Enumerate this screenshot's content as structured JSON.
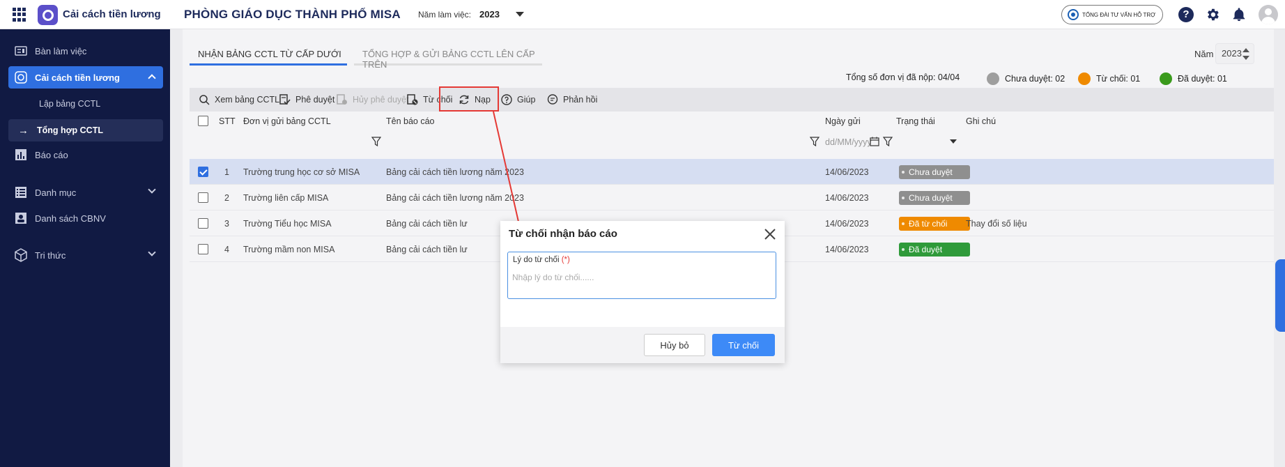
{
  "header": {
    "app_name": "Cải cách tiền lương",
    "org_name": "PHÒNG GIÁO DỤC THÀNH PHỐ MISA",
    "year_label": "Năm làm việc:",
    "year_value": "2023",
    "support_label": "TỔNG ĐÀI TƯ VẤN HỖ TRỢ",
    "help_glyph": "?"
  },
  "sidebar": {
    "items": [
      {
        "label": "Bàn làm việc",
        "icon": "desk-icon"
      },
      {
        "label": "Cải cách tiền lương",
        "icon": "payroll-icon"
      },
      {
        "label": "Lập bảng CCTL"
      },
      {
        "label": "Tổng hợp CCTL"
      },
      {
        "label": "Báo cáo",
        "icon": "report-icon"
      },
      {
        "label": "Danh mục",
        "icon": "list-icon"
      },
      {
        "label": "Danh sách CBNV",
        "icon": "staff-icon"
      },
      {
        "label": "Tri thức",
        "icon": "knowledge-icon"
      }
    ],
    "current_arrow": "→"
  },
  "tabs": [
    {
      "label": "NHẬN BẢNG CCTL TỪ CẤP DƯỚI"
    },
    {
      "label": "TỔNG HỢP & GỬI BẢNG CCTL LÊN CẤP TRÊN"
    }
  ],
  "year_filter": {
    "label": "Năm",
    "value": "2023"
  },
  "summary": {
    "submitted": "Tổng số đơn vị đã nộp: 04/04",
    "pending": "Chưa duyệt: 02",
    "rejected": "Từ chối: 01",
    "approved": "Đã duyệt: 01",
    "colors": {
      "pending": "#9e9e9e",
      "rejected": "#ef8a00",
      "approved": "#3a9a1c"
    }
  },
  "toolbar": {
    "view": "Xem bảng CCTL",
    "approve": "Phê duyệt",
    "unapprove": "Hủy phê duyệt",
    "reject": "Từ chối",
    "reload": "Nạp",
    "help": "Giúp",
    "feedback": "Phản hồi"
  },
  "table": {
    "columns": [
      "STT",
      "Đơn vị gửi bảng CCTL",
      "Tên báo cáo",
      "Ngày gửi",
      "Trạng thái",
      "Ghi chú"
    ],
    "date_placeholder": "dd/MM/yyyy",
    "rows": [
      {
        "stt": "1",
        "unit": "Trường trung học cơ sở MISA",
        "report": "Bảng cải cách tiền lương năm 2023",
        "date": "14/06/2023",
        "status": "Chưa duyệt",
        "note": "",
        "checked": true
      },
      {
        "stt": "2",
        "unit": "Trường liên cấp MISA",
        "report": "Bảng cải cách tiền lương năm 2023",
        "date": "14/06/2023",
        "status": "Chưa duyệt",
        "note": "",
        "checked": false
      },
      {
        "stt": "3",
        "unit": "Trường Tiểu học MISA",
        "report": "Bảng cải cách tiền lư",
        "date": "14/06/2023",
        "status": "Đã từ chối",
        "note": "Thay đổi số liệu",
        "checked": false
      },
      {
        "stt": "4",
        "unit": "Trường mầm non MISA",
        "report": "Bảng cải cách tiền lư",
        "date": "14/06/2023",
        "status": "Đã duyệt",
        "note": "",
        "checked": false
      }
    ],
    "status_colors": {
      "Chưa duyệt": "#8f8f8f",
      "Đã từ chối": "#ef8a00",
      "Đã duyệt": "#2f9a3a"
    }
  },
  "dialog": {
    "title": "Từ chối nhận báo cáo",
    "field_label": "Lý do từ chối",
    "required_mark": "(*)",
    "field_placeholder": "Nhập lý do từ chối......",
    "field_value": "",
    "cancel_label": "Hủy bỏ",
    "reject_label": "Từ chối"
  }
}
